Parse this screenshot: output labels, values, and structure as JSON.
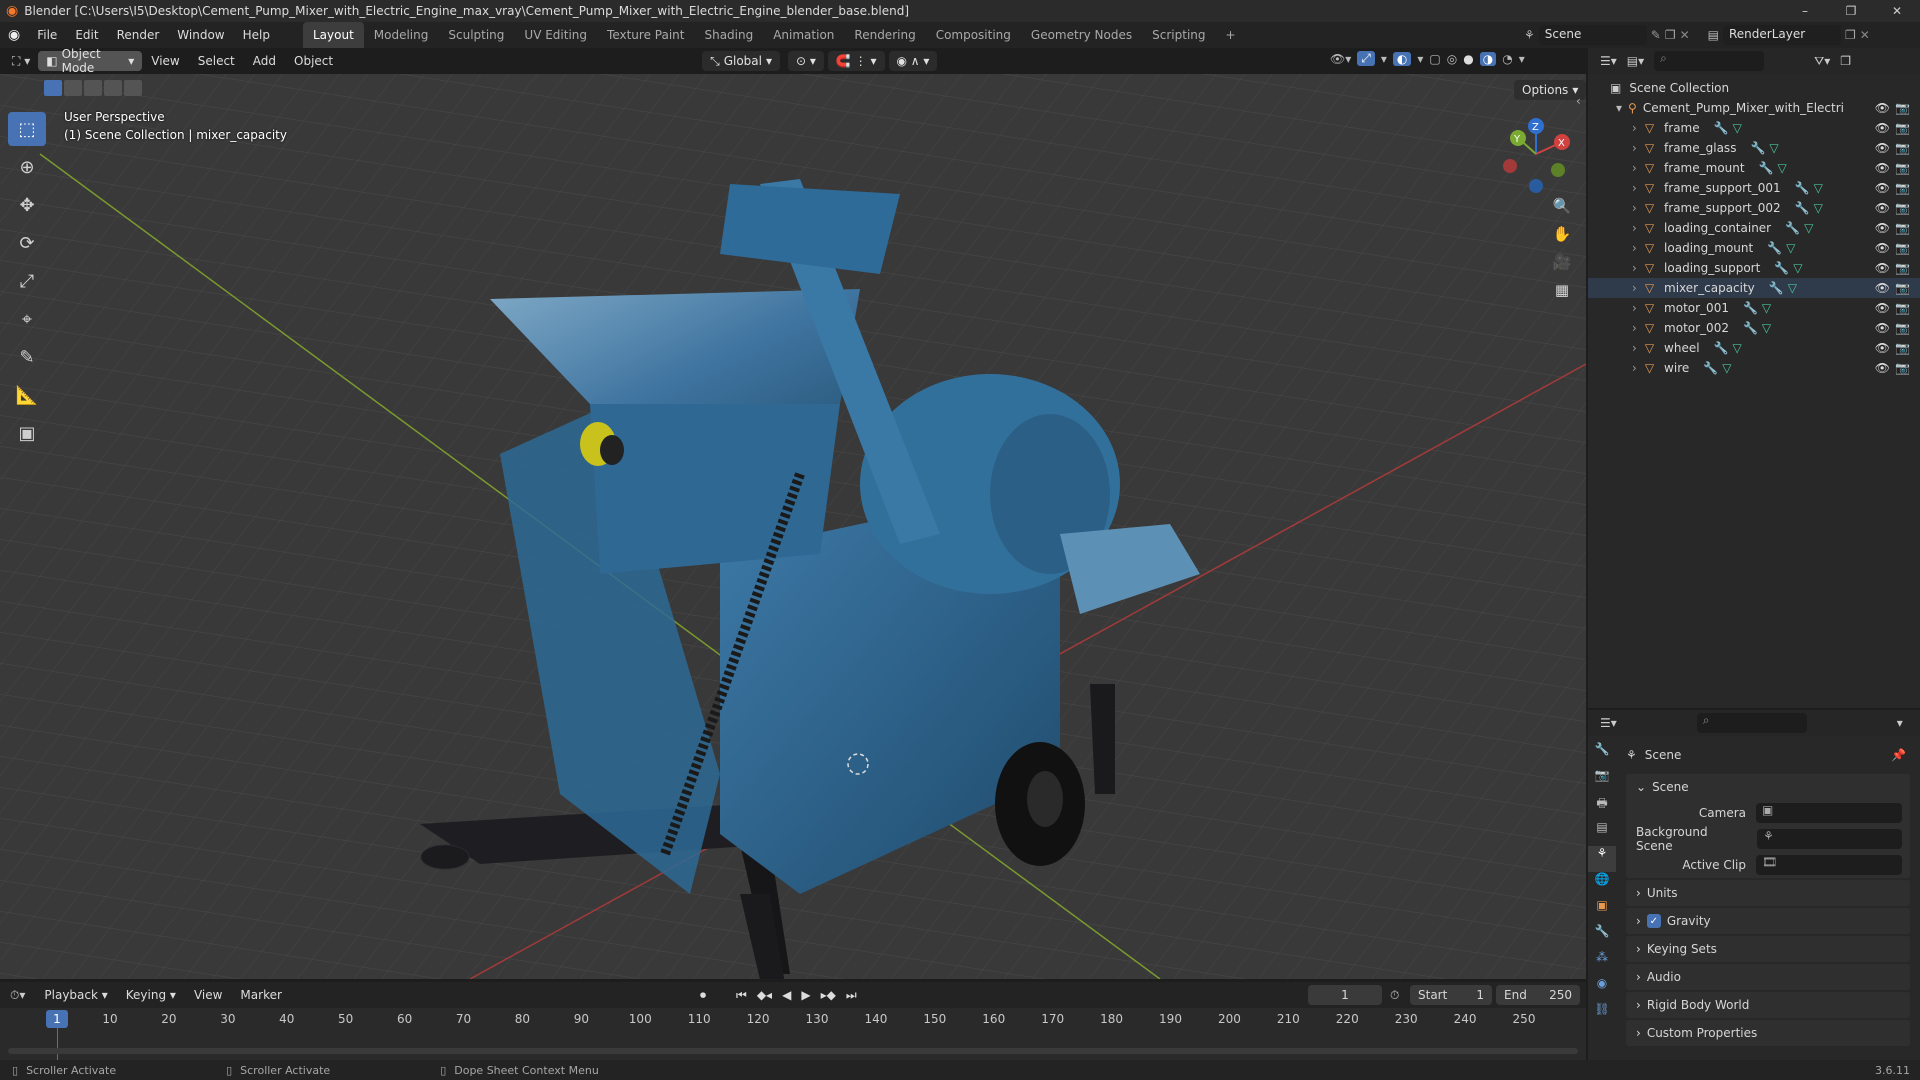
{
  "title_bar": {
    "title": "Blender [C:\\Users\\I5\\Desktop\\Cement_Pump_Mixer_with_Electric_Engine_max_vray\\Cement_Pump_Mixer_with_Electric_Engine_blender_base.blend]"
  },
  "menu": [
    "File",
    "Edit",
    "Render",
    "Window",
    "Help"
  ],
  "workspaces": [
    "Layout",
    "Modeling",
    "Sculpting",
    "UV Editing",
    "Texture Paint",
    "Shading",
    "Animation",
    "Rendering",
    "Compositing",
    "Geometry Nodes",
    "Scripting"
  ],
  "active_workspace": "Layout",
  "scene_selector": {
    "value": "Scene",
    "render_layer": "RenderLayer"
  },
  "viewport_header": {
    "mode": "Object Mode",
    "menus": [
      "View",
      "Select",
      "Add",
      "Object"
    ],
    "orientation": "Global",
    "options": "Options"
  },
  "viewport_overlay": {
    "perspective": "User Perspective",
    "collection": "(1) Scene Collection | mixer_capacity"
  },
  "gizmo": {
    "x": "X",
    "y": "Y",
    "z": "Z"
  },
  "outliner": {
    "root": "Scene Collection",
    "collection": "Cement_Pump_Mixer_with_Electric_Eng",
    "objects": [
      "frame",
      "frame_glass",
      "frame_mount",
      "frame_support_001",
      "frame_support_002",
      "loading_container",
      "loading_mount",
      "loading_support",
      "mixer_capacity",
      "motor_001",
      "motor_002",
      "wheel",
      "wire"
    ],
    "selected": "mixer_capacity"
  },
  "properties": {
    "header": "Scene",
    "panel_title": "Scene",
    "camera_label": "Camera",
    "background_scene_label": "Background Scene",
    "active_clip_label": "Active Clip",
    "sections": [
      "Units",
      "Gravity",
      "Keying Sets",
      "Audio",
      "Rigid Body World",
      "Custom Properties"
    ],
    "gravity_checked": true
  },
  "timeline": {
    "menus": [
      "Playback",
      "Keying",
      "View",
      "Marker"
    ],
    "current_frame": "1",
    "start_label": "Start",
    "start": "1",
    "end_label": "End",
    "end": "250",
    "ruler": [
      "1",
      "10",
      "20",
      "30",
      "40",
      "50",
      "60",
      "70",
      "80",
      "90",
      "100",
      "110",
      "120",
      "130",
      "140",
      "150",
      "160",
      "170",
      "180",
      "190",
      "200",
      "210",
      "220",
      "230",
      "240",
      "250"
    ]
  },
  "status_bar": {
    "items": [
      "Scroller Activate",
      "Scroller Activate",
      "Dope Sheet Context Menu"
    ],
    "version": "3.6.11"
  }
}
